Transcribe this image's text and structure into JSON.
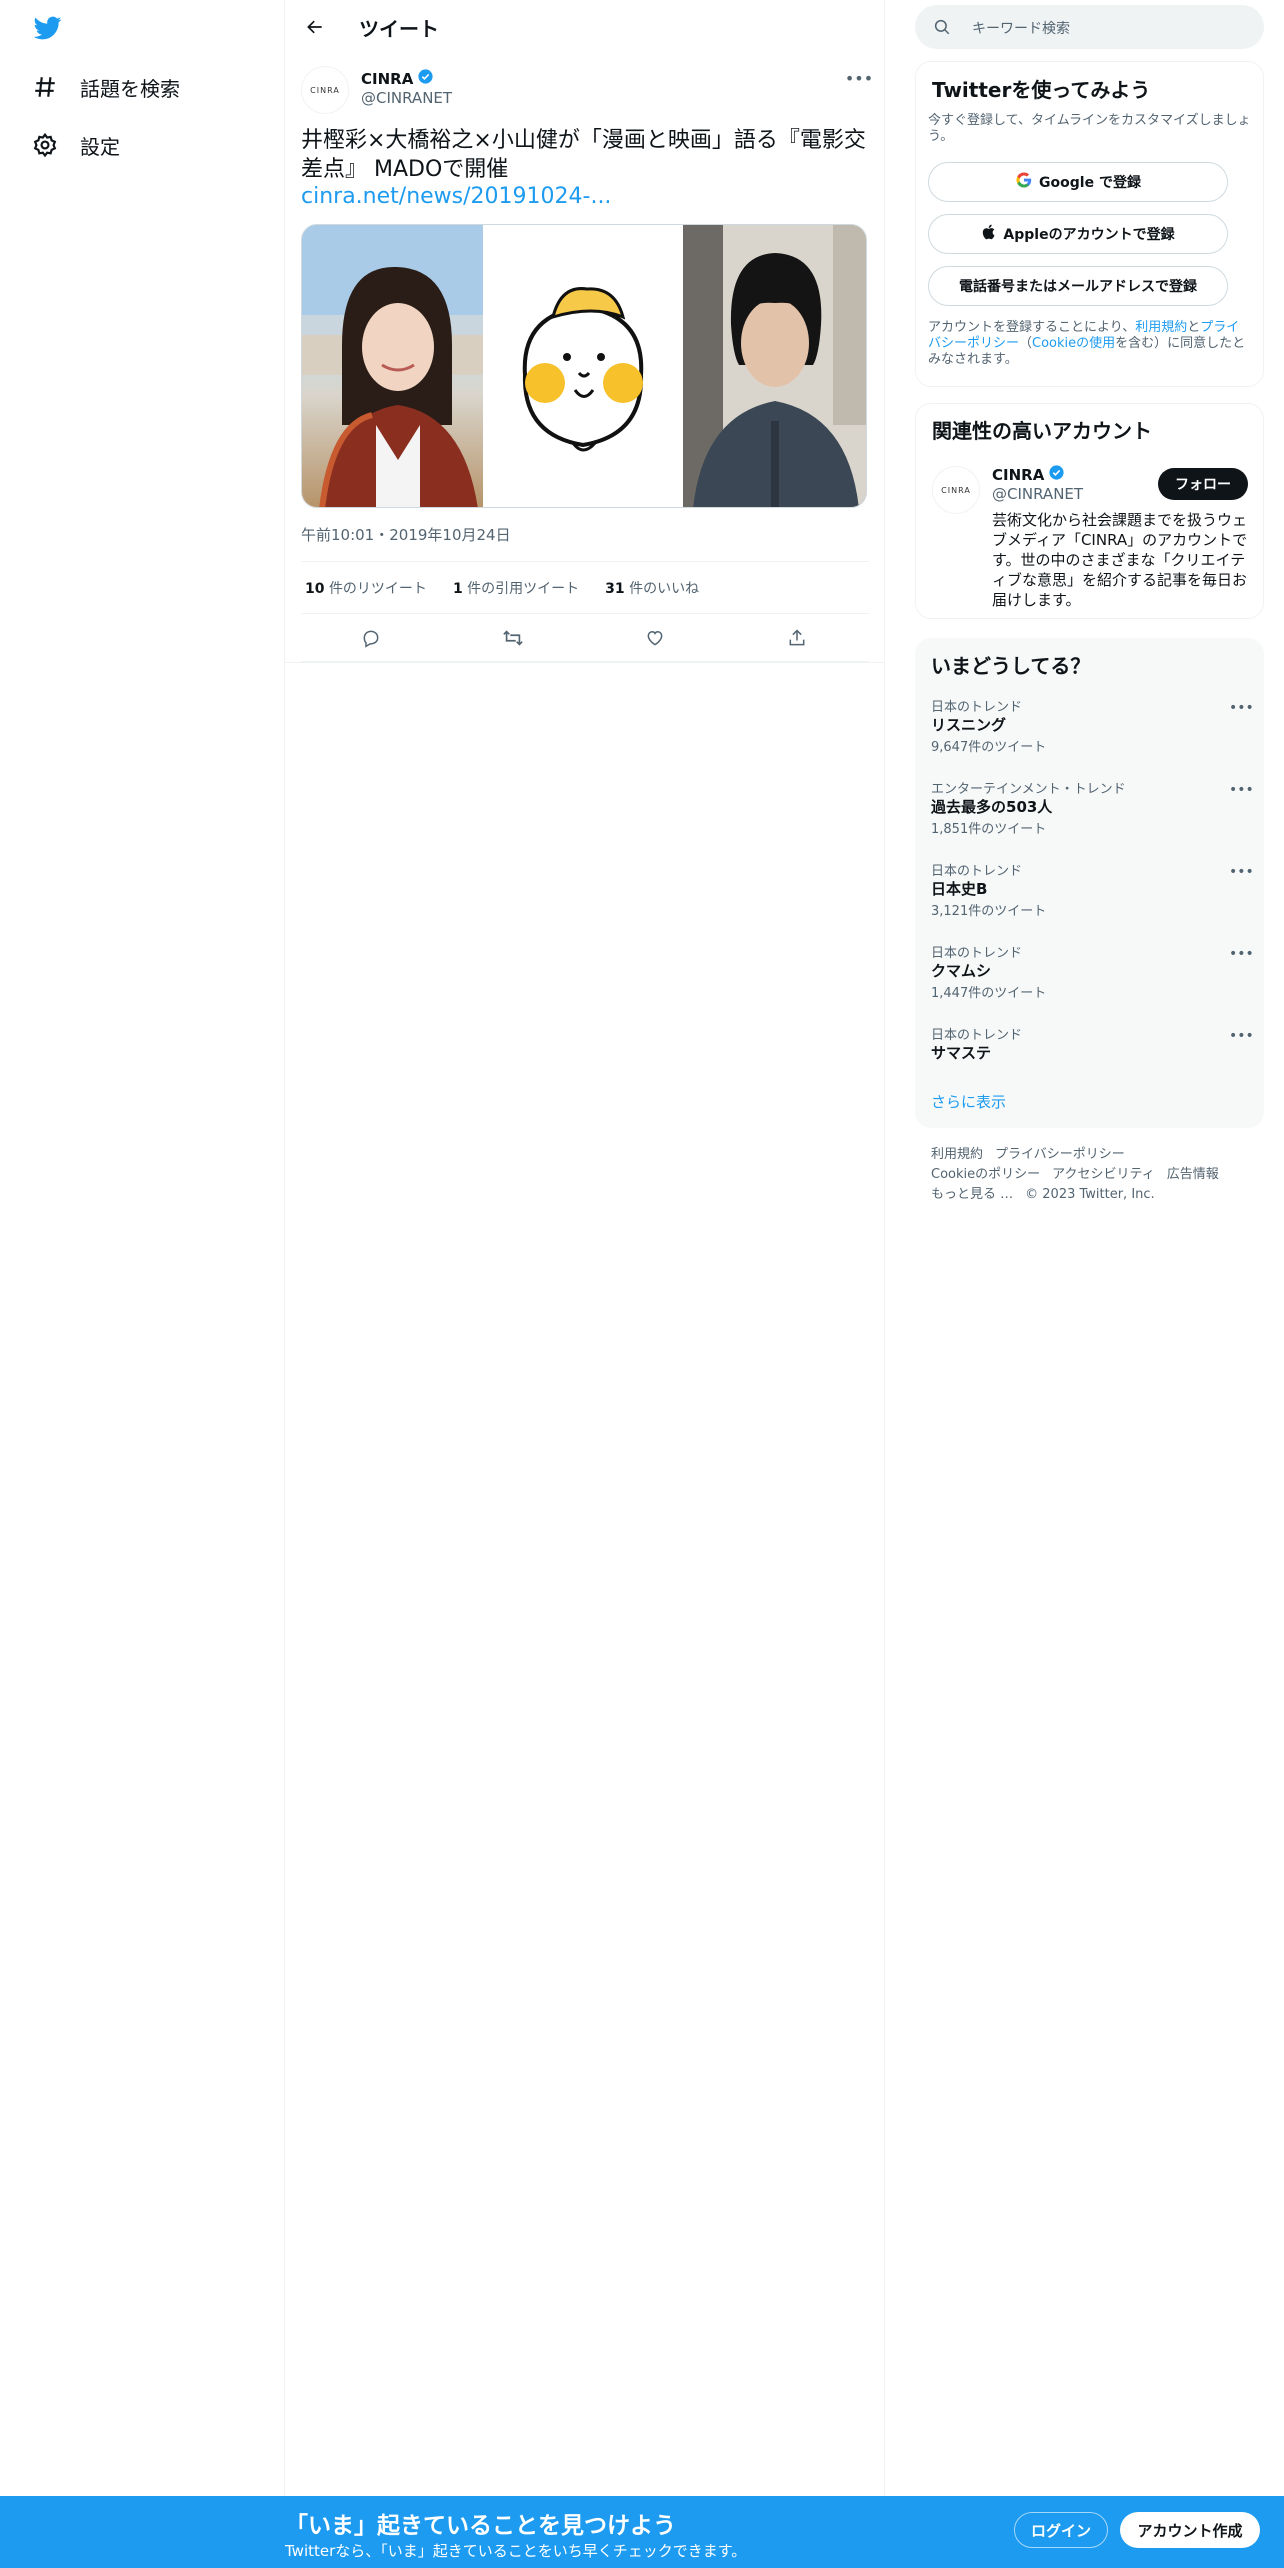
{
  "nav": {
    "items": [
      {
        "label": "話題を検索",
        "icon": "hashtag-icon"
      },
      {
        "label": "設定",
        "icon": "gear-icon"
      }
    ]
  },
  "header": {
    "title": "ツイート"
  },
  "tweet": {
    "author": {
      "name": "CINRA",
      "handle": "@CINRANET",
      "avatar_text": "CINRA"
    },
    "text": "井樫彩×大橋裕之×小山健が「漫画と映画」語る『電影交差点』 MADOで開催",
    "link": "cinra.net/news/20191024-...",
    "timestamp": "午前10:01・2019年10月24日",
    "stats": {
      "retweets_count": "10",
      "retweets_label": "件のリツイート",
      "quotes_count": "1",
      "quotes_label": "件の引用ツイート",
      "likes_count": "31",
      "likes_label": "件のいいね"
    }
  },
  "search": {
    "placeholder": "キーワード検索"
  },
  "signup": {
    "title": "Twitterを使ってみよう",
    "desc": "今すぐ登録して、タイムラインをカスタマイズしましょう。",
    "google_label": "Google で登録",
    "apple_label": "Appleのアカウントで登録",
    "phone_label": "電話番号またはメールアドレスで登録",
    "terms_prefix": "アカウントを登録することにより、",
    "terms_link": "利用規約",
    "terms_and": "と",
    "privacy_link": "プライバシーポリシー",
    "cookie_open": "（",
    "cookie_link": "Cookieの使用",
    "terms_suffix": "を含む）に同意したとみなされます。"
  },
  "related": {
    "title": "関連性の高いアカウント",
    "name": "CINRA",
    "handle": "@CINRANET",
    "follow_label": "フォロー",
    "bio": "芸術文化から社会課題までを扱うウェブメディア「CINRA」のアカウントです。世の中のさまざまな「クリエイティブな意思」を紹介する記事を毎日お届けします。"
  },
  "trends": {
    "title": "いまどうしてる？",
    "items": [
      {
        "category": "日本のトレンド",
        "name": "リスニング",
        "count": "9,647件のツイート"
      },
      {
        "category": "エンターテインメント・トレンド",
        "name": "過去最多の503人",
        "count": "1,851件のツイート"
      },
      {
        "category": "日本のトレンド",
        "name": "日本史B",
        "count": "3,121件のツイート"
      },
      {
        "category": "日本のトレンド",
        "name": "クマムシ",
        "count": "1,447件のツイート"
      },
      {
        "category": "日本のトレンド",
        "name": "サマステ",
        "count": ""
      }
    ],
    "show_more": "さらに表示"
  },
  "footer": {
    "terms": "利用規約",
    "privacy": "プライバシーポリシー",
    "cookie": "Cookieのポリシー",
    "accessibility": "アクセシビリティ",
    "ads": "広告情報",
    "more": "もっと見る …",
    "copyright": "© 2023 Twitter, Inc."
  },
  "banner": {
    "title": "「いま」起きていることを見つけよう",
    "subtitle": "Twitterなら、「いま」起きていることをいち早くチェックできます。",
    "login_label": "ログイン",
    "signup_label": "アカウント作成"
  },
  "colors": {
    "accent": "#1d9bf0",
    "text": "#0f1419",
    "secondary": "#536471"
  }
}
